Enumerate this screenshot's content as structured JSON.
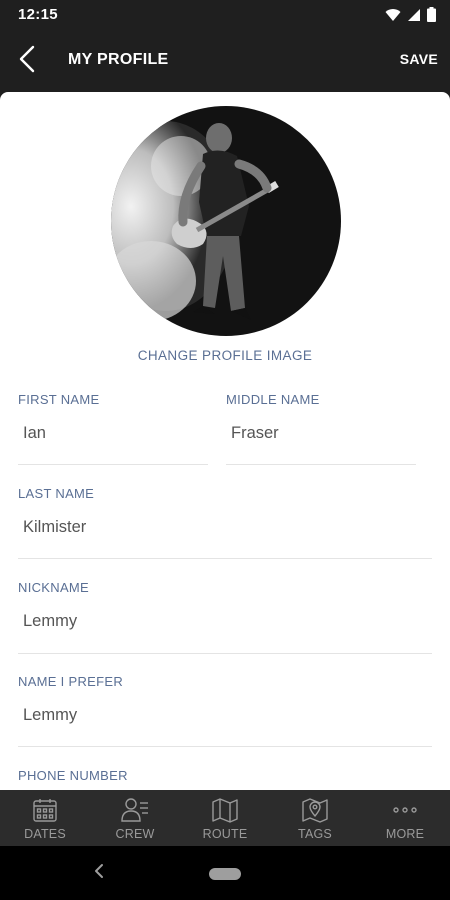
{
  "status_bar": {
    "time": "12:15",
    "icons": [
      "wifi-icon",
      "signal-icon",
      "battery-icon"
    ]
  },
  "app_bar": {
    "back_icon": "chevron-left-icon",
    "title": "MY PROFILE",
    "save_label": "SAVE"
  },
  "profile": {
    "change_image_label": "CHANGE PROFILE IMAGE",
    "fields": {
      "first_name": {
        "label": "FIRST NAME",
        "value": "Ian"
      },
      "middle_name": {
        "label": "MIDDLE NAME",
        "value": "Fraser"
      },
      "last_name": {
        "label": "LAST NAME",
        "value": "Kilmister"
      },
      "nickname": {
        "label": "NICKNAME",
        "value": "Lemmy"
      },
      "name_prefer": {
        "label": "NAME I PREFER",
        "value": "Lemmy"
      },
      "phone_number": {
        "label": "PHONE NUMBER",
        "value": ""
      }
    }
  },
  "bottom_nav": {
    "items": [
      {
        "label": "DATES",
        "icon": "calendar-icon"
      },
      {
        "label": "CREW",
        "icon": "crew-icon"
      },
      {
        "label": "ROUTE",
        "icon": "map-icon"
      },
      {
        "label": "TAGS",
        "icon": "tag-map-icon"
      },
      {
        "label": "MORE",
        "icon": "more-dots-icon"
      }
    ]
  },
  "colors": {
    "dark_bar": "#1f1f1f",
    "nav_bar": "#2c2c2c",
    "label_blue": "#5a6f94",
    "value_gray": "#555555",
    "divider": "#e4e4e4"
  }
}
